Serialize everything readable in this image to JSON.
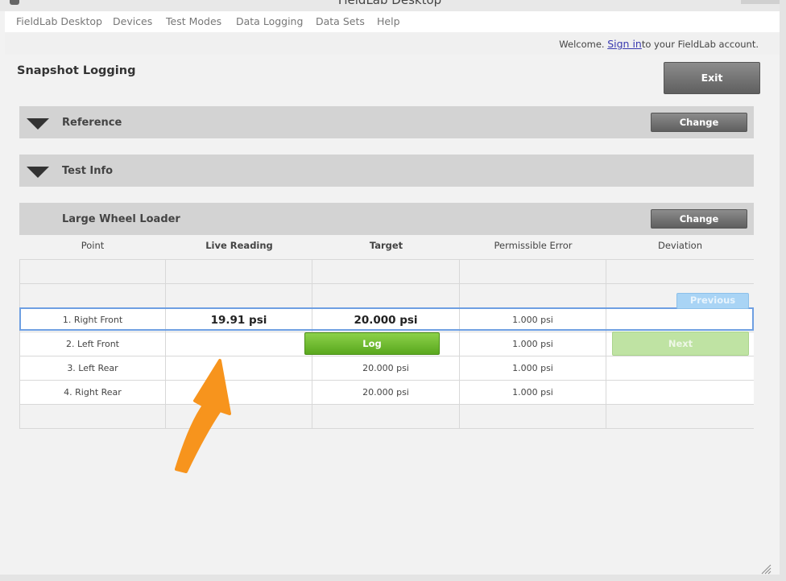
{
  "window": {
    "title": "FieldLab Desktop"
  },
  "menu": {
    "items": [
      {
        "label": "FieldLab Desktop"
      },
      {
        "label": "Devices"
      },
      {
        "label": "Test Modes"
      },
      {
        "label": "Data Logging"
      },
      {
        "label": "Data Sets"
      },
      {
        "label": "Help"
      }
    ]
  },
  "account": {
    "welcome_prefix": "Welcome.",
    "sign_in_label": "Sign in",
    "welcome_suffix": "to your FieldLab account."
  },
  "page": {
    "title": "Snapshot Logging",
    "exit_label": "Exit"
  },
  "panels": {
    "reference": {
      "label": "Reference",
      "change_label": "Change"
    },
    "test_info": {
      "label": "Test Info"
    },
    "machine": {
      "label": "Large Wheel Loader",
      "change_label": "Change"
    }
  },
  "table": {
    "columns": [
      "Point",
      "Live Reading",
      "Target",
      "Permissible Error",
      "Deviation"
    ],
    "rows": [
      {
        "point": "1. Right Front",
        "live": "19.91 psi",
        "target": "20.000 psi",
        "error": "1.000 psi",
        "deviation": ""
      },
      {
        "point": "2. Left Front",
        "live": "",
        "target": "",
        "error": "1.000 psi",
        "deviation": ""
      },
      {
        "point": "3. Left Rear",
        "live": "",
        "target": "20.000 psi",
        "error": "1.000 psi",
        "deviation": ""
      },
      {
        "point": "4. Right Rear",
        "live": "",
        "target": "20.000 psi",
        "error": "1.000 psi",
        "deviation": ""
      }
    ],
    "selected_row": 1
  },
  "buttons": {
    "log_label": "Log",
    "previous_label": "Previous",
    "next_label": "Next"
  },
  "colors": {
    "accent_green": "#6dbb2e",
    "selection_blue": "#6e9fe2",
    "annotation_orange": "#f7941d"
  }
}
